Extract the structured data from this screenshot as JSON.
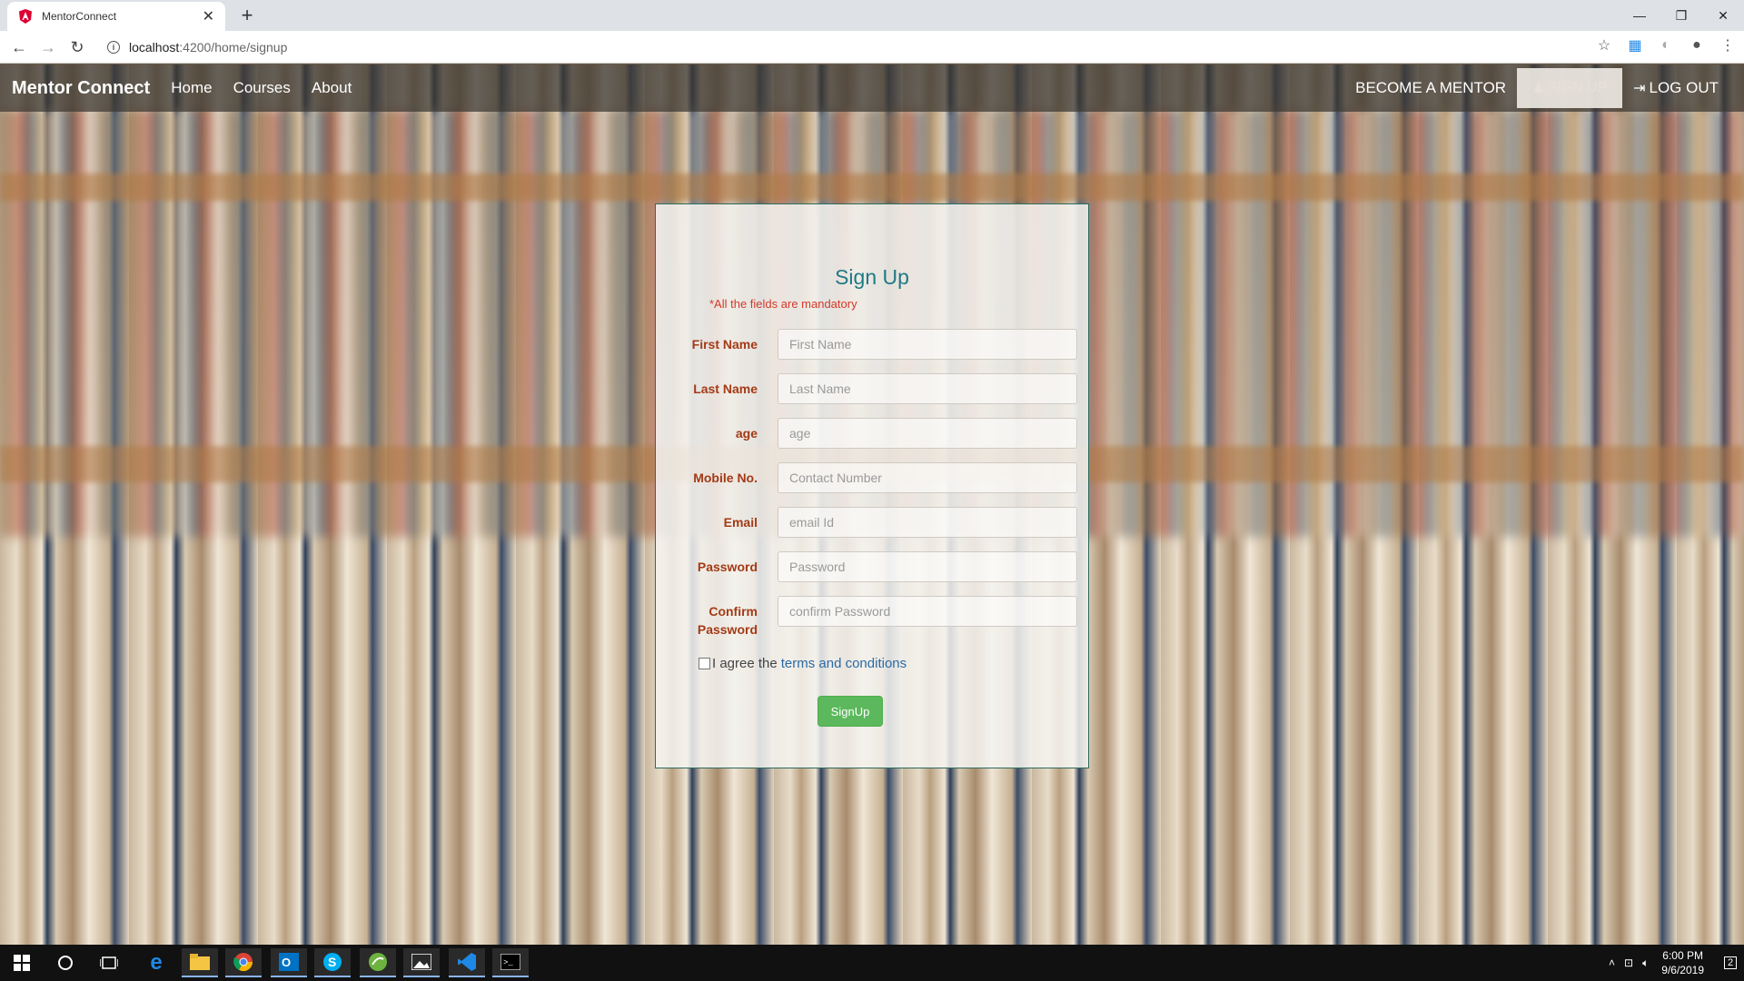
{
  "browser": {
    "tab_title": "MentorConnect",
    "url_host": "localhost",
    "url_rest": ":4200/home/signup",
    "new_tab": "+",
    "tab_close": "✕"
  },
  "navbar": {
    "brand": "Mentor Connect",
    "links": [
      "Home",
      "Courses",
      "About"
    ],
    "become_mentor": "BECOME A MENTOR",
    "sign_up": "SIGN UP",
    "log_out": "LOG OUT"
  },
  "form": {
    "title": "Sign Up",
    "mandatory_note": "*All the fields are mandatory",
    "fields": [
      {
        "label": "First Name",
        "placeholder": "First Name"
      },
      {
        "label": "Last Name",
        "placeholder": "Last Name"
      },
      {
        "label": "age",
        "placeholder": "age"
      },
      {
        "label": "Mobile No.",
        "placeholder": "Contact Number"
      },
      {
        "label": "Email",
        "placeholder": "email Id"
      },
      {
        "label": "Password",
        "placeholder": "Password"
      },
      {
        "label_line1": "Confirm",
        "label_line2": "Password",
        "placeholder": "confirm Password"
      }
    ],
    "agree_text": "I agree the",
    "terms_link": "terms and conditions",
    "submit": "SignUp"
  },
  "taskbar": {
    "time": "6:00 PM",
    "date": "9/6/2019",
    "notification_count": "2"
  }
}
